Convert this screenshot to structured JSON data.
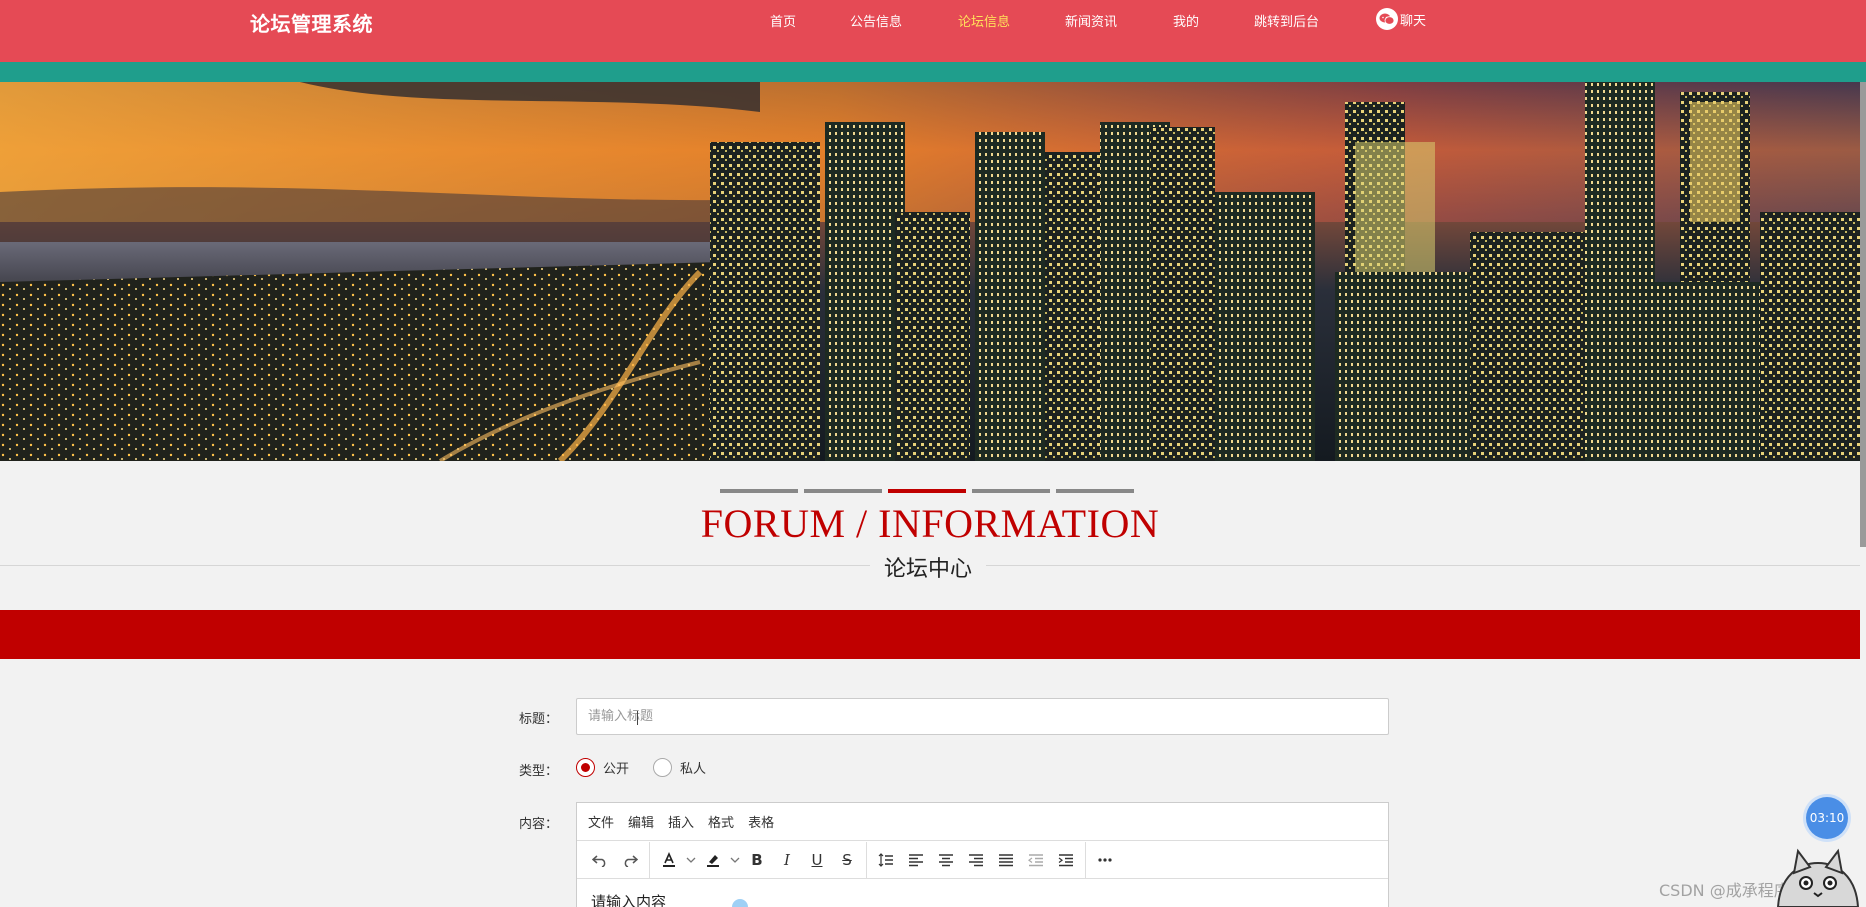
{
  "header": {
    "brand": "论坛管理系统",
    "nav": [
      "首页",
      "公告信息",
      "论坛信息",
      "新闻资讯",
      "我的",
      "跳转到后台"
    ],
    "active_nav": "论坛信息",
    "chat_label": "聊天"
  },
  "section": {
    "title_en": "FORUM / INFORMATION",
    "title_cn": "论坛中心"
  },
  "form": {
    "title_label": "标题：",
    "title_placeholder": "请输入标题",
    "type_label": "类型：",
    "type_options": [
      "公开",
      "私人"
    ],
    "type_selected": "公开",
    "content_label": "内容：",
    "editor_menus": [
      "文件",
      "编辑",
      "插入",
      "格式",
      "表格"
    ],
    "editor_placeholder": "请输入内容"
  },
  "overlay": {
    "timer": "03:10",
    "watermark": "CSDN @成承程序设计"
  },
  "colors": {
    "nav_bg": "#e54a55",
    "accent": "#c00000",
    "teal": "#1f9e8c",
    "active_nav": "#ffe05a"
  }
}
